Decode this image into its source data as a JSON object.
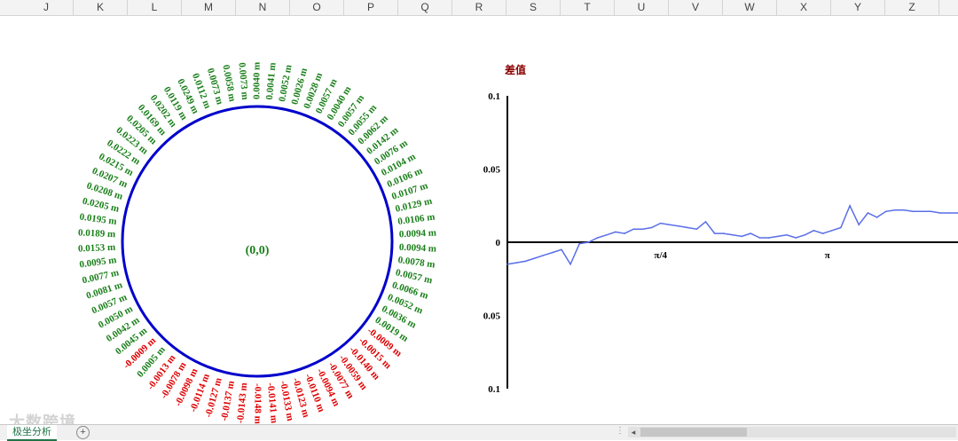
{
  "columns": [
    "J",
    "K",
    "L",
    "M",
    "N",
    "O",
    "P",
    "Q",
    "R",
    "S",
    "T",
    "U",
    "V",
    "W",
    "X",
    "Y",
    "Z"
  ],
  "sheet_tab": "极坐分析",
  "add_sheet_icon": "plus-circle-icon",
  "watermark": "大数跨境",
  "chart_data": [
    {
      "type": "polar-labels",
      "center_label": "(0,0)",
      "positive_color": "#1a7f1a",
      "negative_color": "#e00000",
      "circle_color": "#0000cc",
      "labels": [
        "0.0040 m",
        "0.0041 m",
        "0.0052 m",
        "0.0026 m",
        "0.0028 m",
        "0.0057 m",
        "0.0040 m",
        "0.0057 m",
        "0.0055 m",
        "0.0062 m",
        "0.0142 m",
        "0.0076 m",
        "0.0104 m",
        "0.0106 m",
        "0.0107 m",
        "0.0129 m",
        "0.0106 m",
        "0.0094 m",
        "0.0094 m",
        "0.0078 m",
        "0.0057 m",
        "0.0066 m",
        "0.0052 m",
        "0.0036 m",
        "0.0019 m",
        "-0.0009 m",
        "-0.0015 m",
        "-0.0140 m",
        "-0.0059 m",
        "-0.0077 m",
        "-0.0094 m",
        "-0.0110 m",
        "-0.0123 m",
        "-0.0133 m",
        "-0.0141 m",
        "-0.0148 m",
        "-0.0143 m",
        "-0.0137 m",
        "-0.0127 m",
        "-0.0114 m",
        "-0.0098 m",
        "-0.0078 m",
        "-0.0013 m",
        "0.0005 m",
        "-0.0009 m",
        "0.0045 m",
        "0.0042 m",
        "0.0050 m",
        "0.0057 m",
        "0.0081 m",
        "0.0077 m",
        "0.0095 m",
        "0.0153 m",
        "0.0189 m",
        "0.0195 m",
        "0.0205 m",
        "0.0208 m",
        "0.0207 m",
        "0.0215 m",
        "0.0222 m",
        "0.0223 m",
        "0.0205 m",
        "0.0169 m",
        "0.0202 m",
        "0.0119 m",
        "0.0249 m",
        "0.0112 m",
        "0.0073 m",
        "0.0058 m",
        "0.0073 m"
      ]
    },
    {
      "type": "line",
      "title": "差值",
      "y_tick_labels": [
        "0.1",
        "0.05",
        "0",
        "0.05",
        "0.1"
      ],
      "x_tick_labels": [
        "π/4",
        "π"
      ],
      "ylim": [
        -0.1,
        0.1
      ],
      "series_color": "#5a6ee8",
      "x": [
        0,
        0.02,
        0.04,
        0.06,
        0.08,
        0.1,
        0.12,
        0.14,
        0.16,
        0.18,
        0.2,
        0.22,
        0.24,
        0.26,
        0.28,
        0.3,
        0.32,
        0.34,
        0.36,
        0.38,
        0.4,
        0.42,
        0.44,
        0.46,
        0.48,
        0.5,
        0.52,
        0.54,
        0.56,
        0.58,
        0.6,
        0.62,
        0.64,
        0.66,
        0.68,
        0.7,
        0.72,
        0.74,
        0.76,
        0.78,
        0.8,
        0.82,
        0.84,
        0.86,
        0.88,
        0.9,
        0.92,
        0.94,
        0.96,
        0.98,
        1.0
      ],
      "values": [
        -0.015,
        -0.014,
        -0.013,
        -0.011,
        -0.009,
        -0.007,
        -0.005,
        -0.015,
        -0.001,
        0.0,
        0.003,
        0.005,
        0.007,
        0.006,
        0.009,
        0.009,
        0.01,
        0.013,
        0.012,
        0.011,
        0.01,
        0.009,
        0.014,
        0.006,
        0.006,
        0.005,
        0.004,
        0.006,
        0.003,
        0.003,
        0.004,
        0.005,
        0.003,
        0.005,
        0.008,
        0.006,
        0.008,
        0.01,
        0.025,
        0.012,
        0.02,
        0.017,
        0.021,
        0.022,
        0.022,
        0.021,
        0.021,
        0.021,
        0.02,
        0.02,
        0.02
      ]
    }
  ]
}
